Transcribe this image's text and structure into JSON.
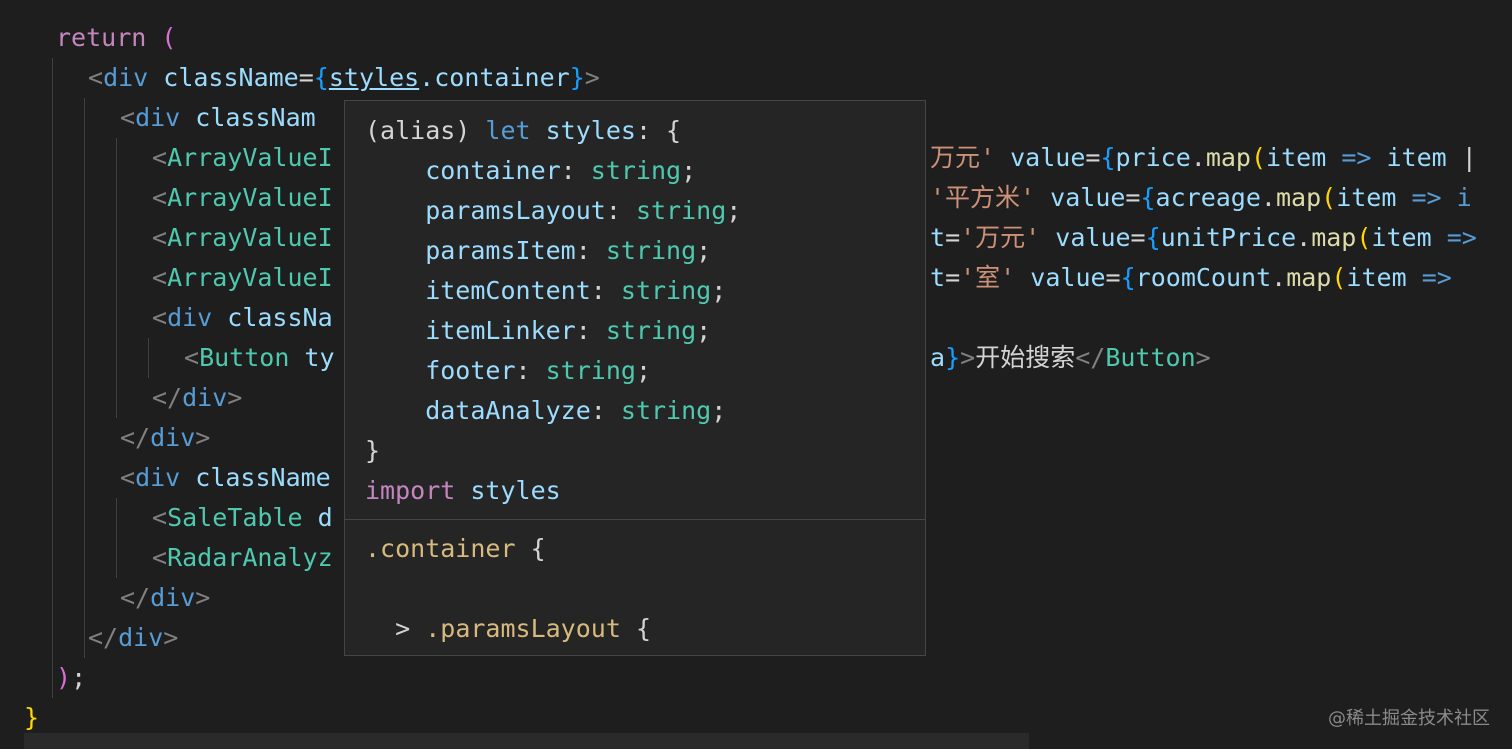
{
  "editor": {
    "lines": [
      [
        {
          "t": "return",
          "c": "kw"
        },
        {
          "t": " ",
          "c": "txt"
        },
        {
          "t": "(",
          "c": "br2"
        }
      ],
      [
        {
          "t": "<",
          "c": "ang"
        },
        {
          "t": "div",
          "c": "tag"
        },
        {
          "t": " className",
          "c": "attr"
        },
        {
          "t": "=",
          "c": "txt"
        },
        {
          "t": "{",
          "c": "br3"
        },
        {
          "t": "styles",
          "c": "attr under"
        },
        {
          "t": ".container",
          "c": "attr"
        },
        {
          "t": "}",
          "c": "br3"
        },
        {
          "t": ">",
          "c": "ang"
        }
      ],
      [
        {
          "t": "<",
          "c": "ang"
        },
        {
          "t": "div",
          "c": "tag"
        },
        {
          "t": " classNam",
          "c": "attr"
        }
      ],
      [
        {
          "t": "<",
          "c": "ang"
        },
        {
          "t": "ArrayValueI",
          "c": "comp"
        }
      ],
      [
        {
          "t": "<",
          "c": "ang"
        },
        {
          "t": "ArrayValueI",
          "c": "comp"
        }
      ],
      [
        {
          "t": "<",
          "c": "ang"
        },
        {
          "t": "ArrayValueI",
          "c": "comp"
        }
      ],
      [
        {
          "t": "<",
          "c": "ang"
        },
        {
          "t": "ArrayValueI",
          "c": "comp"
        }
      ],
      [
        {
          "t": "<",
          "c": "ang"
        },
        {
          "t": "div",
          "c": "tag"
        },
        {
          "t": " classNa",
          "c": "attr"
        }
      ],
      [
        {
          "t": "<",
          "c": "ang"
        },
        {
          "t": "Button",
          "c": "comp"
        },
        {
          "t": " ty",
          "c": "attr"
        }
      ],
      [
        {
          "t": "</",
          "c": "ang"
        },
        {
          "t": "div",
          "c": "tag"
        },
        {
          "t": ">",
          "c": "ang"
        }
      ],
      [
        {
          "t": "</",
          "c": "ang"
        },
        {
          "t": "div",
          "c": "tag"
        },
        {
          "t": ">",
          "c": "ang"
        }
      ],
      [
        {
          "t": "<",
          "c": "ang"
        },
        {
          "t": "div",
          "c": "tag"
        },
        {
          "t": " className",
          "c": "attr"
        }
      ],
      [
        {
          "t": "<",
          "c": "ang"
        },
        {
          "t": "SaleTable",
          "c": "comp"
        },
        {
          "t": " d",
          "c": "attr"
        }
      ],
      [
        {
          "t": "<",
          "c": "ang"
        },
        {
          "t": "RadarAnalyz",
          "c": "comp"
        }
      ],
      [
        {
          "t": "</",
          "c": "ang"
        },
        {
          "t": "div",
          "c": "tag"
        },
        {
          "t": ">",
          "c": "ang"
        }
      ],
      [
        {
          "t": "</",
          "c": "ang"
        },
        {
          "t": "div",
          "c": "tag"
        },
        {
          "t": ">",
          "c": "ang"
        }
      ],
      [
        {
          "t": ")",
          "c": "br2"
        },
        {
          "t": ";",
          "c": "txt"
        }
      ],
      [
        {
          "t": "}",
          "c": "br1"
        }
      ]
    ],
    "right_lines": [
      {
        "row": 3,
        "tokens": [
          {
            "t": "万元'",
            "c": "str"
          },
          {
            "t": " value",
            "c": "attr"
          },
          {
            "t": "=",
            "c": "txt"
          },
          {
            "t": "{",
            "c": "br3"
          },
          {
            "t": "price",
            "c": "attr"
          },
          {
            "t": ".",
            "c": "txt"
          },
          {
            "t": "map",
            "c": "fn"
          },
          {
            "t": "(",
            "c": "br1"
          },
          {
            "t": "item",
            "c": "attr"
          },
          {
            "t": " => ",
            "c": "tag"
          },
          {
            "t": "item",
            "c": "attr"
          },
          {
            "t": " |",
            "c": "txt"
          }
        ]
      },
      {
        "row": 4,
        "tokens": [
          {
            "t": "'平方米'",
            "c": "str"
          },
          {
            "t": " value",
            "c": "attr"
          },
          {
            "t": "=",
            "c": "txt"
          },
          {
            "t": "{",
            "c": "br3"
          },
          {
            "t": "acreage",
            "c": "attr"
          },
          {
            "t": ".",
            "c": "txt"
          },
          {
            "t": "map",
            "c": "fn"
          },
          {
            "t": "(",
            "c": "br1"
          },
          {
            "t": "item",
            "c": "attr"
          },
          {
            "t": " => i",
            "c": "tag"
          }
        ]
      },
      {
        "row": 5,
        "tokens": [
          {
            "t": "t",
            "c": "attr"
          },
          {
            "t": "=",
            "c": "txt"
          },
          {
            "t": "'万元'",
            "c": "str"
          },
          {
            "t": " value",
            "c": "attr"
          },
          {
            "t": "=",
            "c": "txt"
          },
          {
            "t": "{",
            "c": "br3"
          },
          {
            "t": "unitPrice",
            "c": "attr"
          },
          {
            "t": ".",
            "c": "txt"
          },
          {
            "t": "map",
            "c": "fn"
          },
          {
            "t": "(",
            "c": "br1"
          },
          {
            "t": "item",
            "c": "attr"
          },
          {
            "t": " =>",
            "c": "tag"
          }
        ]
      },
      {
        "row": 6,
        "tokens": [
          {
            "t": "t",
            "c": "attr"
          },
          {
            "t": "=",
            "c": "txt"
          },
          {
            "t": "'室'",
            "c": "str"
          },
          {
            "t": " value",
            "c": "attr"
          },
          {
            "t": "=",
            "c": "txt"
          },
          {
            "t": "{",
            "c": "br3"
          },
          {
            "t": "roomCount",
            "c": "attr"
          },
          {
            "t": ".",
            "c": "txt"
          },
          {
            "t": "map",
            "c": "fn"
          },
          {
            "t": "(",
            "c": "br1"
          },
          {
            "t": "item",
            "c": "attr"
          },
          {
            "t": " =>",
            "c": "tag"
          }
        ]
      },
      {
        "row": 8,
        "tokens": [
          {
            "t": "a",
            "c": "attr"
          },
          {
            "t": "}",
            "c": "br3"
          },
          {
            "t": ">",
            "c": "ang"
          },
          {
            "t": "开始搜索",
            "c": "txt"
          },
          {
            "t": "</",
            "c": "ang"
          },
          {
            "t": "Button",
            "c": "comp"
          },
          {
            "t": ">",
            "c": "ang"
          }
        ]
      }
    ]
  },
  "hover": {
    "lines": [
      [
        {
          "t": "(alias) ",
          "c": "txt"
        },
        {
          "t": "let",
          "c": "tag"
        },
        {
          "t": " styles",
          "c": "prop"
        },
        {
          "t": ": {",
          "c": "txt"
        }
      ],
      [
        {
          "t": "    container",
          "c": "prop"
        },
        {
          "t": ": ",
          "c": "txt"
        },
        {
          "t": "string",
          "c": "tp"
        },
        {
          "t": ";",
          "c": "txt"
        }
      ],
      [
        {
          "t": "    paramsLayout",
          "c": "prop"
        },
        {
          "t": ": ",
          "c": "txt"
        },
        {
          "t": "string",
          "c": "tp"
        },
        {
          "t": ";",
          "c": "txt"
        }
      ],
      [
        {
          "t": "    paramsItem",
          "c": "prop"
        },
        {
          "t": ": ",
          "c": "txt"
        },
        {
          "t": "string",
          "c": "tp"
        },
        {
          "t": ";",
          "c": "txt"
        }
      ],
      [
        {
          "t": "    itemContent",
          "c": "prop"
        },
        {
          "t": ": ",
          "c": "txt"
        },
        {
          "t": "string",
          "c": "tp"
        },
        {
          "t": ";",
          "c": "txt"
        }
      ],
      [
        {
          "t": "    itemLinker",
          "c": "prop"
        },
        {
          "t": ": ",
          "c": "txt"
        },
        {
          "t": "string",
          "c": "tp"
        },
        {
          "t": ";",
          "c": "txt"
        }
      ],
      [
        {
          "t": "    footer",
          "c": "prop"
        },
        {
          "t": ": ",
          "c": "txt"
        },
        {
          "t": "string",
          "c": "tp"
        },
        {
          "t": ";",
          "c": "txt"
        }
      ],
      [
        {
          "t": "    dataAnalyze",
          "c": "prop"
        },
        {
          "t": ": ",
          "c": "txt"
        },
        {
          "t": "string",
          "c": "tp"
        },
        {
          "t": ";",
          "c": "txt"
        }
      ],
      [
        {
          "t": "}",
          "c": "txt"
        }
      ],
      [
        {
          "t": "import",
          "c": "kw"
        },
        {
          "t": " styles",
          "c": "prop"
        }
      ]
    ],
    "css_lines": [
      [
        {
          "t": ".container",
          "c": "cls"
        },
        {
          "t": " {",
          "c": "txt"
        }
      ],
      [
        {
          "t": "",
          "c": "txt"
        }
      ],
      [
        {
          "t": "  > ",
          "c": "txt"
        },
        {
          "t": ".paramsLayout",
          "c": "cls"
        },
        {
          "t": " {",
          "c": "txt"
        }
      ]
    ]
  },
  "watermark": "@稀土掘金技术社区",
  "colors": {
    "background": "#1e1e1e",
    "hover_bg": "#252526",
    "hover_border": "#454545"
  }
}
